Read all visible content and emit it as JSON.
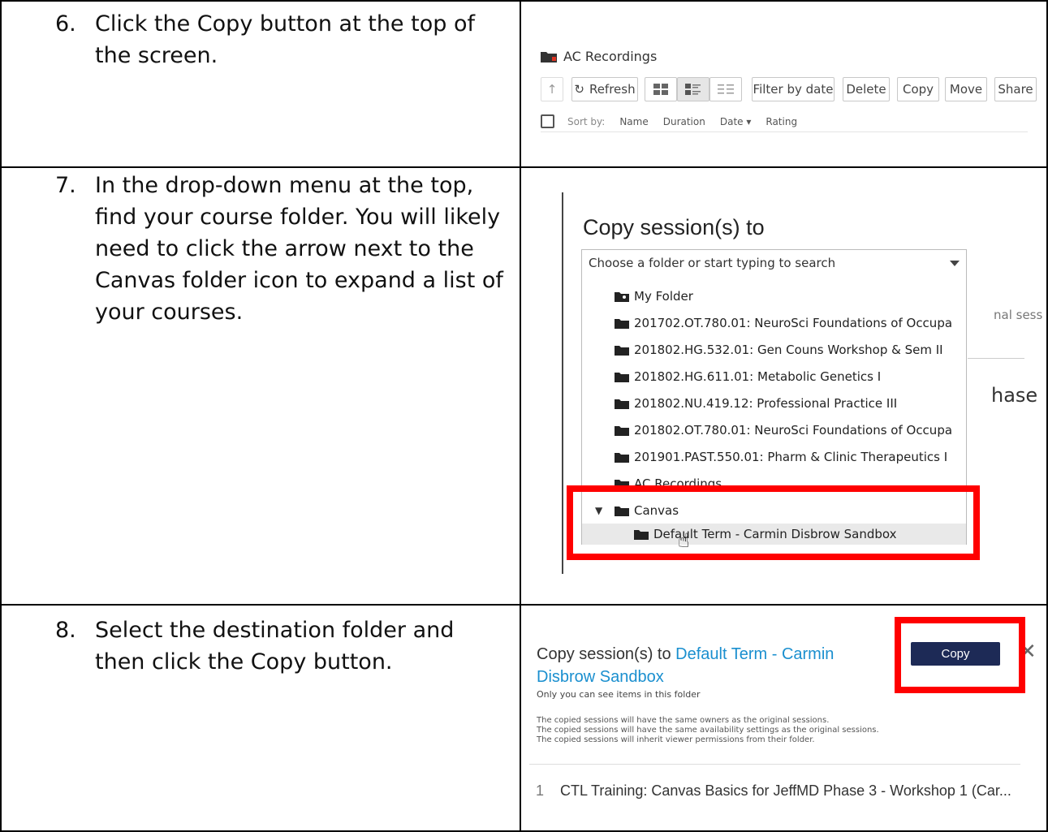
{
  "steps": [
    {
      "number": "6.",
      "text": "Click the Copy button at the top of the screen."
    },
    {
      "number": "7.",
      "text": "In the drop-down menu at the top, find your course folder. You will likely need to click the arrow next to the Canvas folder icon to expand a list of your courses."
    },
    {
      "number": "8.",
      "text": "Select the destination folder and then click the Copy button."
    }
  ],
  "panel1": {
    "folder_title": "AC Recordings",
    "toolbar": {
      "up_icon": "↑",
      "refresh": "Refresh",
      "filter_by_date": "Filter by date",
      "delete": "Delete",
      "copy": "Copy",
      "move": "Move",
      "share": "Share"
    },
    "sort": {
      "label": "Sort by:",
      "name": "Name",
      "duration": "Duration",
      "date": "Date ▾",
      "rating": "Rating"
    }
  },
  "panel2": {
    "heading": "Copy session(s) to",
    "select_placeholder": "Choose a folder or start typing to search",
    "folders": [
      "My Folder",
      "201702.OT.780.01: NeuroSci Foundations of Occupa",
      "201802.HG.532.01: Gen Couns Workshop & Sem II",
      "201802.HG.611.01: Metabolic Genetics I",
      "201802.NU.419.12: Professional Practice III",
      "201802.OT.780.01: NeuroSci Foundations of Occupa",
      "201901.PAST.550.01: Pharm & Clinic Therapeutics I",
      "AC Recordings",
      "Canvas",
      "Default Term - Carmin Disbrow Sandbox"
    ],
    "behind_text_1": "nal sess",
    "behind_text_2": "hase"
  },
  "panel3": {
    "title_prefix": "Copy session(s) to ",
    "title_link": "Default Term - Carmin Disbrow Sandbox",
    "subtitle": "Only you can see items in this folder",
    "notes": [
      "The copied sessions will have the same owners as the original sessions.",
      "The copied sessions will have the same availability settings as the original sessions.",
      "The copied sessions will inherit viewer permissions from their folder."
    ],
    "copy_button": "Copy",
    "close": "✕",
    "row_index": "1",
    "row_title": "CTL Training: Canvas Basics for JeffMD Phase 3 - Workshop 1 (Car..."
  },
  "colors": {
    "highlight_red": "#ff0000",
    "link_blue": "#1a8fcf",
    "copy_button_navy": "#1d2a56"
  }
}
